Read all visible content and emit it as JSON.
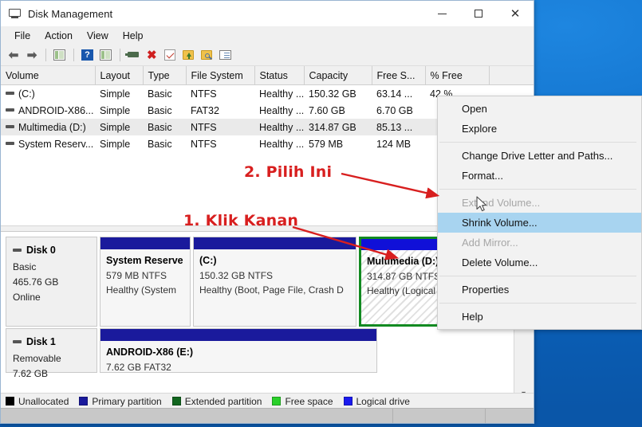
{
  "window": {
    "title": "Disk Management",
    "title_icon": "disk-management-icon",
    "controls": {
      "minimize": "minimize-icon",
      "maximize": "maximize-icon",
      "close": "close-icon"
    }
  },
  "menubar": {
    "items": [
      "File",
      "Action",
      "View",
      "Help"
    ]
  },
  "toolbar": {
    "items": [
      {
        "name": "back-icon",
        "glyph": "←"
      },
      {
        "name": "forward-icon",
        "glyph": "→"
      },
      {
        "name": "show-hide-console-tree-icon"
      },
      {
        "name": "help-icon",
        "glyph": "?"
      },
      {
        "name": "show-hide-action-pane-icon"
      },
      {
        "name": "rescan-disks-icon"
      },
      {
        "name": "delete-icon",
        "glyph": "✖"
      },
      {
        "name": "properties-icon"
      },
      {
        "name": "export-list-icon"
      },
      {
        "name": "explore-icon"
      },
      {
        "name": "view-list-icon"
      }
    ]
  },
  "volume_list": {
    "columns": [
      "Volume",
      "Layout",
      "Type",
      "File System",
      "Status",
      "Capacity",
      "Free S...",
      "% Free",
      ""
    ],
    "rows": [
      {
        "volume": "(C:)",
        "layout": "Simple",
        "type": "Basic",
        "fs": "NTFS",
        "status": "Healthy ...",
        "capacity": "150.32 GB",
        "free": "63.14 ...",
        "pct": "42 %",
        "selected": false
      },
      {
        "volume": "ANDROID-X86...",
        "layout": "Simple",
        "type": "Basic",
        "fs": "FAT32",
        "status": "Healthy ...",
        "capacity": "7.60 GB",
        "free": "6.70 GB",
        "pct": "",
        "selected": false
      },
      {
        "volume": "Multimedia (D:)",
        "layout": "Simple",
        "type": "Basic",
        "fs": "NTFS",
        "status": "Healthy ...",
        "capacity": "314.87 GB",
        "free": "85.13 ...",
        "pct": "",
        "selected": true
      },
      {
        "volume": "System Reserv...",
        "layout": "Simple",
        "type": "Basic",
        "fs": "NTFS",
        "status": "Healthy ...",
        "capacity": "579 MB",
        "free": "124 MB",
        "pct": "",
        "selected": false
      }
    ]
  },
  "disks": [
    {
      "name": "Disk 0",
      "type": "Basic",
      "size": "465.76 GB",
      "state": "Online",
      "partitions": [
        {
          "label": "System Reserve",
          "size_fs": "579 MB NTFS",
          "status": "Healthy (System",
          "selected": false
        },
        {
          "label": "(C:)",
          "size_fs": "150.32 GB NTFS",
          "status": "Healthy (Boot, Page File, Crash D",
          "selected": false
        },
        {
          "label": "Multimedia  (D:)",
          "size_fs": "314.87 GB NTFS",
          "status": "Healthy (Logical Drive)",
          "selected": true
        }
      ]
    },
    {
      "name": "Disk 1",
      "type": "Removable",
      "size": "7.62 GB",
      "state": "",
      "partitions": [
        {
          "label": "ANDROID-X86  (E:)",
          "size_fs": "7.62 GB FAT32",
          "status": "",
          "selected": false
        }
      ]
    }
  ],
  "legend": [
    {
      "label": "Unallocated",
      "color": "#000000"
    },
    {
      "label": "Primary partition",
      "color": "#1a1a9c"
    },
    {
      "label": "Extended partition",
      "color": "#12661f"
    },
    {
      "label": "Free space",
      "color": "#2ad02a"
    },
    {
      "label": "Logical drive",
      "color": "#1a1aee"
    }
  ],
  "context_menu": {
    "items": [
      {
        "label": "Open",
        "state": "enabled"
      },
      {
        "label": "Explore",
        "state": "enabled"
      },
      {
        "separator": true
      },
      {
        "label": "Change Drive Letter and Paths...",
        "state": "enabled"
      },
      {
        "label": "Format...",
        "state": "enabled"
      },
      {
        "separator": true
      },
      {
        "label": "Extend Volume...",
        "state": "disabled"
      },
      {
        "label": "Shrink Volume...",
        "state": "highlighted"
      },
      {
        "label": "Add Mirror...",
        "state": "disabled"
      },
      {
        "label": "Delete Volume...",
        "state": "enabled"
      },
      {
        "separator": true
      },
      {
        "label": "Properties",
        "state": "enabled"
      },
      {
        "separator": true
      },
      {
        "label": "Help",
        "state": "enabled"
      }
    ]
  },
  "annotations": [
    {
      "name": "annotation-step-2",
      "text": "2. Pilih Ini",
      "color": "#d81f1f"
    },
    {
      "name": "annotation-step-1",
      "text": "1. Klik Kanan",
      "color": "#d81f1f"
    }
  ],
  "cursor": {
    "name": "mouse-pointer"
  }
}
